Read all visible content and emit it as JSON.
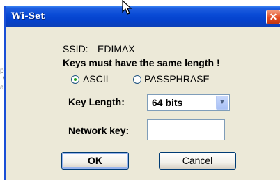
{
  "dialog": {
    "title": "Wi-Set",
    "close_icon": "close-icon",
    "ssid_label": "SSID:",
    "ssid_value": "EDIMAX",
    "warning": "Keys must have the same length !",
    "radio_ascii": "ASCII",
    "radio_passphrase": "PASSPHRASE",
    "selected_mode": "ASCII",
    "key_length_label": "Key Length:",
    "key_length_value": "64 bits",
    "network_key_label": "Network key:",
    "network_key_value": "",
    "ok_label": "OK",
    "cancel_label": "Cancel"
  },
  "background_window": {
    "frag1": "pe",
    "frag2": "V",
    "frag3": "ar"
  },
  "colors": {
    "titlebar": "#0a4bd6",
    "dialog_bg": "#ece9d8",
    "close_button": "#e24b22"
  }
}
